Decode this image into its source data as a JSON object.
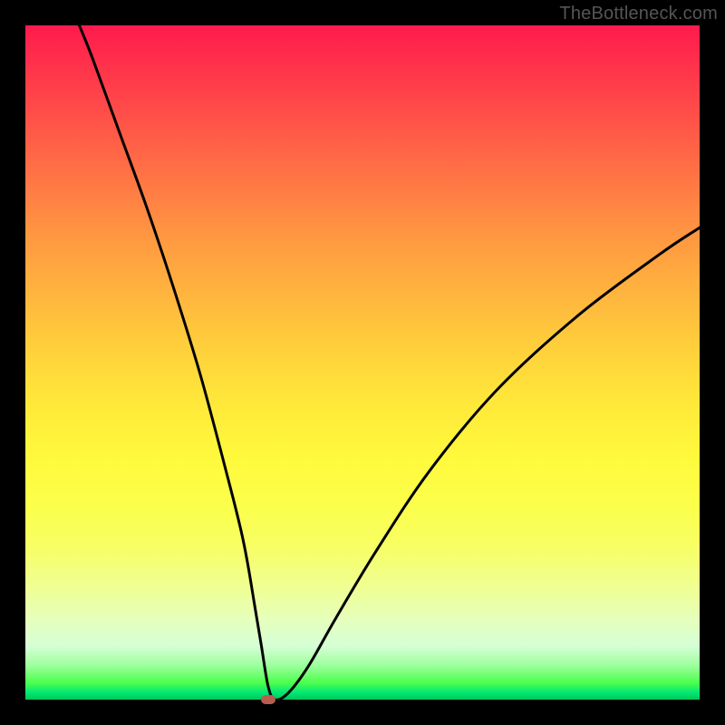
{
  "watermark": "TheBottleneck.com",
  "colors": {
    "gradient_top": "#ff1a4d",
    "gradient_bottom": "#00c853",
    "curve": "#000000",
    "marker": "#b85c50",
    "frame": "#000000"
  },
  "chart_data": {
    "type": "line",
    "title": "",
    "xlabel": "",
    "ylabel": "",
    "xlim": [
      0,
      100
    ],
    "ylim": [
      0,
      100
    ],
    "grid": false,
    "legend": false,
    "marker": {
      "x": 36,
      "y": 0
    },
    "series": [
      {
        "name": "curve",
        "x": [
          8,
          10,
          14,
          18,
          22,
          26,
          30,
          32,
          33,
          34,
          35,
          36,
          37,
          39,
          42,
          46,
          52,
          60,
          70,
          82,
          94,
          100
        ],
        "values": [
          100,
          95,
          84,
          73,
          61,
          48,
          33,
          25,
          20,
          14,
          8,
          2,
          0,
          1,
          5,
          12,
          22,
          34,
          46,
          57,
          66,
          70
        ]
      }
    ]
  }
}
